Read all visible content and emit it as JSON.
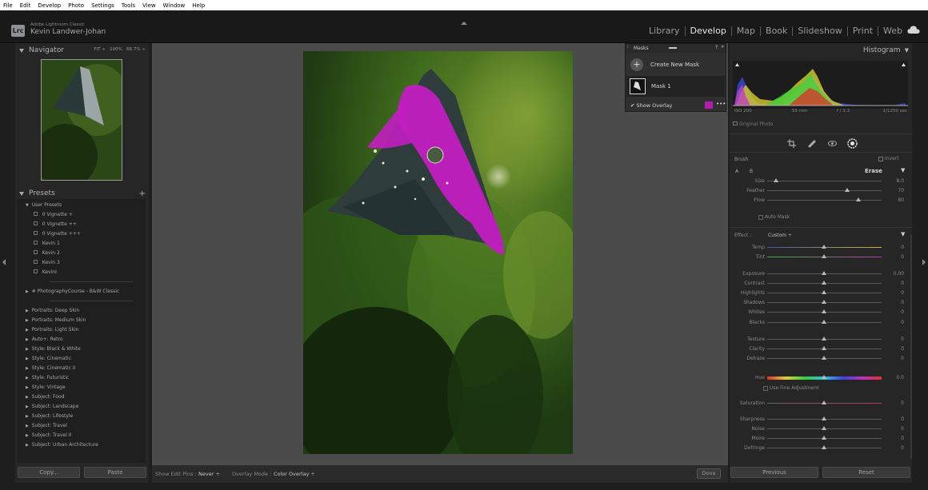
{
  "menubar": [
    "File",
    "Edit",
    "Develop",
    "Photo",
    "Settings",
    "Tools",
    "View",
    "Window",
    "Help"
  ],
  "identity": {
    "logo": "Lrc",
    "app_name": "Adobe Lightroom Classic",
    "user_name": "Kevin Landwer-Johan"
  },
  "modules": [
    "Library",
    "Develop",
    "Map",
    "Book",
    "Slideshow",
    "Print",
    "Web"
  ],
  "active_module": "Develop",
  "navigator": {
    "title": "Navigator",
    "zoom_options": [
      "FIT ÷",
      "100%",
      "66.7% ÷"
    ]
  },
  "presets": {
    "title": "Presets",
    "add": "+",
    "user_group": "User Presets",
    "user_items": [
      "0 Vignette +",
      "0 Vignette ++",
      "0 Vignette +++",
      "Kevin 1",
      "Kevin 2",
      "Kevin 3",
      "KevinI"
    ],
    "groups": [
      "# PhotographyCourse - B&W Classic",
      "Portraits: Deep Skin",
      "Portraits: Medium Skin",
      "Portraits: Light Skin",
      "Auto+: Retro",
      "Style: Black & White",
      "Style: Cinematic",
      "Style: Cinematic II",
      "Style: Futuristic",
      "Style: Vintage",
      "Subject: Food",
      "Subject: Landscape",
      "Subject: Lifestyle",
      "Subject: Travel",
      "Subject: Travel II",
      "Subject: Urban Architecture"
    ]
  },
  "left_buttons": {
    "copy": "Copy...",
    "paste": "Paste"
  },
  "toolbar": {
    "show_edit_pins_label": "Show Edit Pins :",
    "show_edit_pins_value": "Never ÷",
    "overlay_mode_label": "Overlay Mode :",
    "overlay_mode_value": "Color Overlay ÷",
    "done": "Done"
  },
  "masks": {
    "title": "Masks",
    "create": "Create New Mask",
    "mask1": "Mask 1",
    "show_overlay": "Show Overlay",
    "overlay_color": "#b21fb0"
  },
  "histogram": {
    "title": "Histogram",
    "info": [
      "ISO 200",
      "55 mm",
      "f / 3.3",
      "1/1250 sec"
    ],
    "original_photo": "Original Photo"
  },
  "brush": {
    "title": "Brush",
    "invert": "Invert",
    "a": "A",
    "b": "B",
    "erase": "Erase",
    "size_label": "Size",
    "size_value": "8.0",
    "size_level": 0.08,
    "feather_label": "Feather",
    "feather_value": "70",
    "feather_level": 0.7,
    "flow_label": "Flow",
    "flow_value": "80",
    "flow_level": 0.8,
    "auto_mask": "Auto Mask"
  },
  "effect": {
    "label": "Effect :",
    "value": "Custom ÷",
    "sliders": [
      {
        "label": "Temp",
        "value": "0"
      },
      {
        "label": "Tint",
        "value": "0"
      },
      {
        "label": "Exposure",
        "value": "0.00"
      },
      {
        "label": "Contrast",
        "value": "0"
      },
      {
        "label": "Highlights",
        "value": "0"
      },
      {
        "label": "Shadows",
        "value": "0"
      },
      {
        "label": "Whites",
        "value": "0"
      },
      {
        "label": "Blacks",
        "value": "0"
      },
      {
        "label": "Texture",
        "value": "0"
      },
      {
        "label": "Clarity",
        "value": "0"
      },
      {
        "label": "Dehaze",
        "value": "0"
      },
      {
        "label": "Hue",
        "value": "0.0"
      },
      {
        "label": "Saturation",
        "value": "0"
      },
      {
        "label": "Sharpness",
        "value": "0"
      },
      {
        "label": "Noise",
        "value": "0"
      },
      {
        "label": "Moire",
        "value": "0"
      },
      {
        "label": "Defringe",
        "value": "0"
      }
    ],
    "use_fine": "Use Fine Adjustment"
  },
  "right_buttons": {
    "previous": "Previous",
    "reset": "Reset"
  }
}
